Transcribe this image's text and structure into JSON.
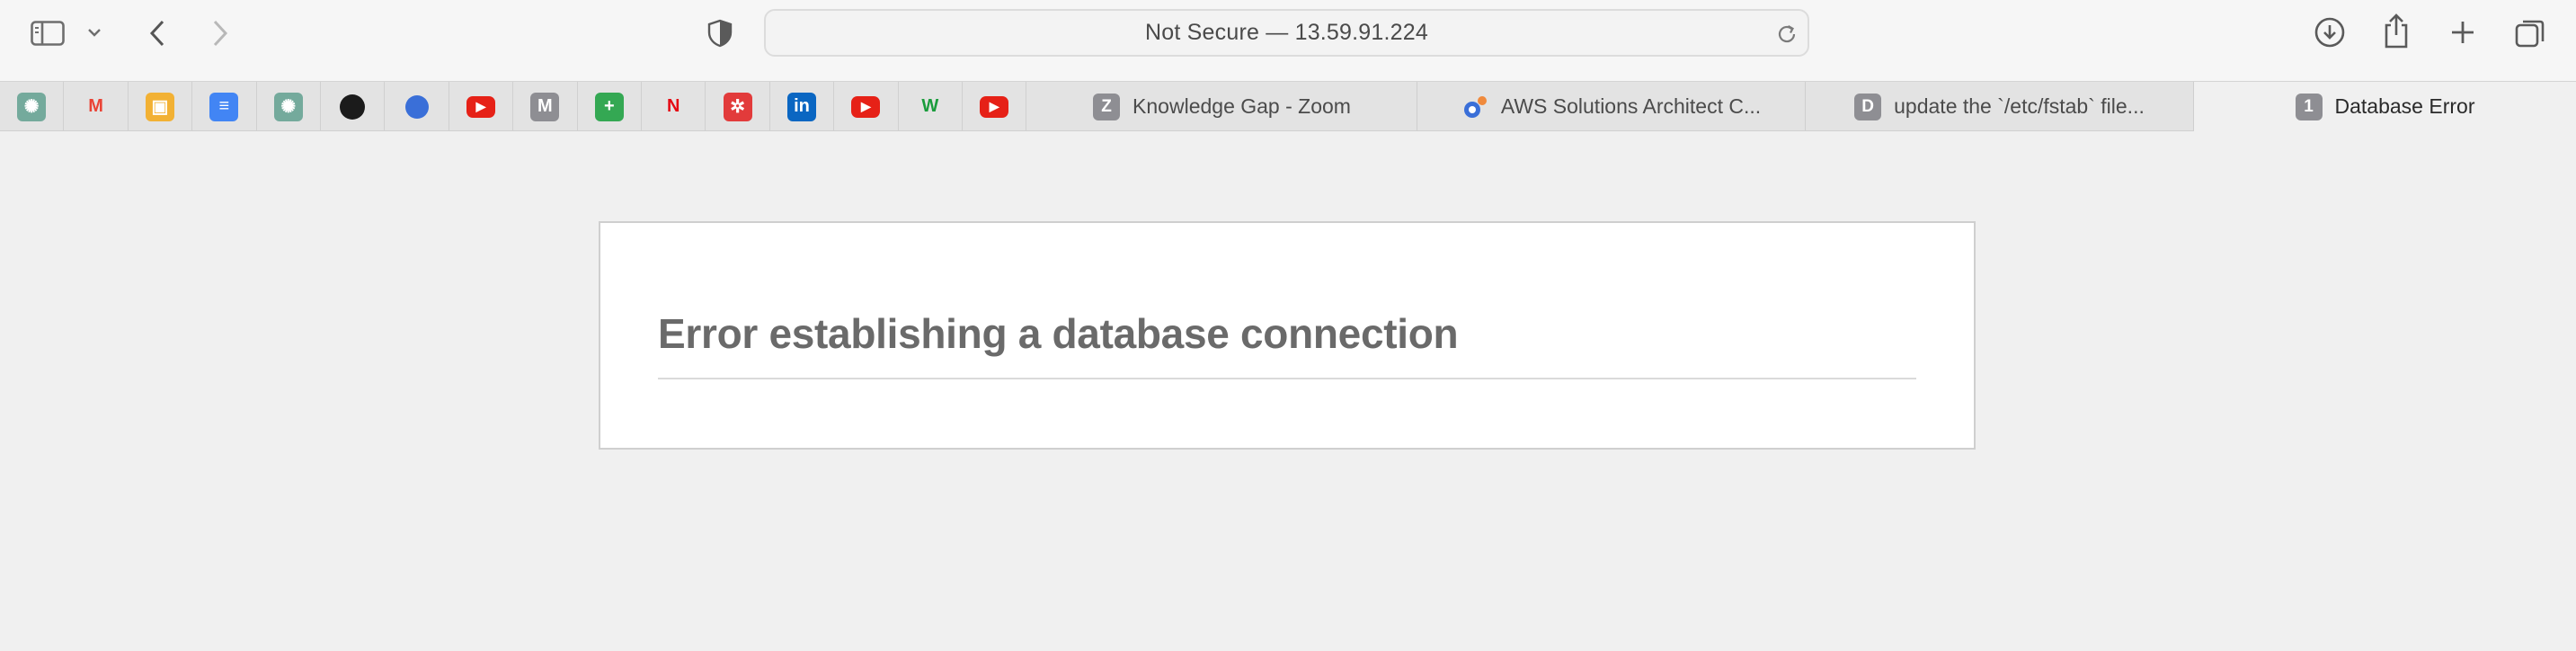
{
  "browser": {
    "address_text": "Not Secure — 13.59.91.224",
    "toolbar_icons": [
      "sidebar-icon",
      "chevron-down-icon",
      "back-icon",
      "forward-icon",
      "privacy-shield-icon",
      "reload-icon",
      "download-icon",
      "share-icon",
      "new-tab-icon",
      "tab-overview-icon"
    ]
  },
  "pinned_tabs": [
    {
      "icon": "chatgpt-icon",
      "color": "#74aa9c",
      "glyph": "✺"
    },
    {
      "icon": "gmail-icon",
      "color": "#ffffff",
      "glyph": "M"
    },
    {
      "icon": "box-icon",
      "color": "#f2b134",
      "glyph": "▣"
    },
    {
      "icon": "google-docs-icon",
      "color": "#4285f4",
      "glyph": "≡"
    },
    {
      "icon": "chatgpt-icon",
      "color": "#74aa9c",
      "glyph": "✺"
    },
    {
      "icon": "github-icon",
      "color": "#1b1b1b",
      "glyph": "●"
    },
    {
      "icon": "app-icon",
      "color": "#3a6fd8",
      "glyph": "●"
    },
    {
      "icon": "youtube-icon",
      "color": "#e62117",
      "glyph": "▶"
    },
    {
      "icon": "medium-icon",
      "color": "#8e8e93",
      "glyph": "M"
    },
    {
      "icon": "google-sheets-icon",
      "color": "#34a853",
      "glyph": "+"
    },
    {
      "icon": "netflix-icon",
      "color": "#ffffff",
      "glyph": "N"
    },
    {
      "icon": "settings-wheel-icon",
      "color": "#e23b3b",
      "glyph": "✲"
    },
    {
      "icon": "linkedin-icon",
      "color": "#0a66c2",
      "glyph": "in"
    },
    {
      "icon": "youtube-icon",
      "color": "#e62117",
      "glyph": "▶"
    },
    {
      "icon": "w3schools-icon",
      "color": "#ffffff",
      "glyph": "W"
    },
    {
      "icon": "youtube-icon",
      "color": "#e62117",
      "glyph": "▶"
    }
  ],
  "tabs": [
    {
      "label": "Knowledge Gap - Zoom",
      "badge": "Z",
      "badge_color": "#8e8e93"
    },
    {
      "label": "AWS Solutions Architect C...",
      "badge": "",
      "badge_color": "#3a6fd8"
    },
    {
      "label": "update the `/etc/fstab` file...",
      "badge": "D",
      "badge_color": "#8e8e93"
    },
    {
      "label": "Database Error",
      "badge": "1",
      "badge_color": "#8e8e93",
      "active": true
    }
  ],
  "page": {
    "error_title": "Error establishing a database connection"
  }
}
